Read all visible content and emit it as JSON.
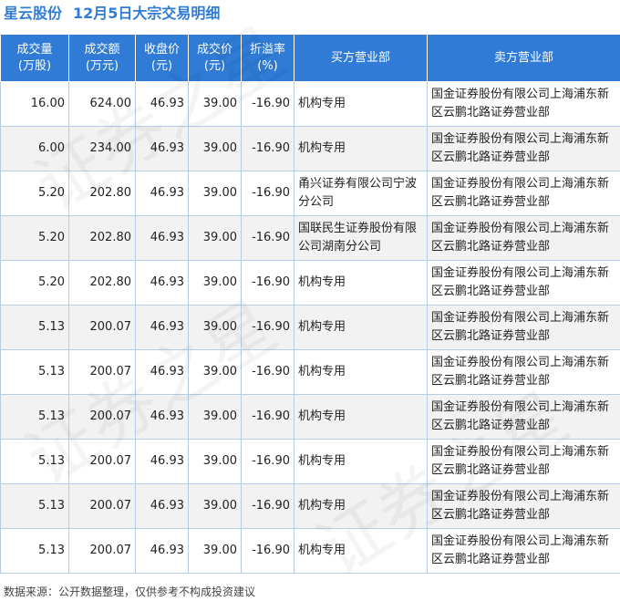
{
  "title": {
    "stock_name": "星云股份",
    "subtitle": "12月5日大宗交易明细"
  },
  "columns": [
    {
      "line1": "成交量",
      "line2": "(万股)"
    },
    {
      "line1": "成交额",
      "line2": "(万元)"
    },
    {
      "line1": "收盘价",
      "line2": "(元)"
    },
    {
      "line1": "成交价",
      "line2": "(元)"
    },
    {
      "line1": "折溢率",
      "line2": "(%)"
    },
    {
      "line1": "买方营业部",
      "line2": ""
    },
    {
      "line1": "卖方营业部",
      "line2": ""
    }
  ],
  "rows": [
    {
      "volume": "16.00",
      "amount": "624.00",
      "close": "46.93",
      "price": "39.00",
      "premium": "-16.90",
      "buyer": "机构专用",
      "seller": "国金证券股份有限公司上海浦东新区云鹏北路证券营业部"
    },
    {
      "volume": "6.00",
      "amount": "234.00",
      "close": "46.93",
      "price": "39.00",
      "premium": "-16.90",
      "buyer": "机构专用",
      "seller": "国金证券股份有限公司上海浦东新区云鹏北路证券营业部"
    },
    {
      "volume": "5.20",
      "amount": "202.80",
      "close": "46.93",
      "price": "39.00",
      "premium": "-16.90",
      "buyer": "甬兴证券有限公司宁波分公司",
      "seller": "国金证券股份有限公司上海浦东新区云鹏北路证券营业部"
    },
    {
      "volume": "5.20",
      "amount": "202.80",
      "close": "46.93",
      "price": "39.00",
      "premium": "-16.90",
      "buyer": "国联民生证券股份有限公司湖南分公司",
      "seller": "国金证券股份有限公司上海浦东新区云鹏北路证券营业部"
    },
    {
      "volume": "5.20",
      "amount": "202.80",
      "close": "46.93",
      "price": "39.00",
      "premium": "-16.90",
      "buyer": "机构专用",
      "seller": "国金证券股份有限公司上海浦东新区云鹏北路证券营业部"
    },
    {
      "volume": "5.13",
      "amount": "200.07",
      "close": "46.93",
      "price": "39.00",
      "premium": "-16.90",
      "buyer": "机构专用",
      "seller": "国金证券股份有限公司上海浦东新区云鹏北路证券营业部"
    },
    {
      "volume": "5.13",
      "amount": "200.07",
      "close": "46.93",
      "price": "39.00",
      "premium": "-16.90",
      "buyer": "机构专用",
      "seller": "国金证券股份有限公司上海浦东新区云鹏北路证券营业部"
    },
    {
      "volume": "5.13",
      "amount": "200.07",
      "close": "46.93",
      "price": "39.00",
      "premium": "-16.90",
      "buyer": "机构专用",
      "seller": "国金证券股份有限公司上海浦东新区云鹏北路证券营业部"
    },
    {
      "volume": "5.13",
      "amount": "200.07",
      "close": "46.93",
      "price": "39.00",
      "premium": "-16.90",
      "buyer": "机构专用",
      "seller": "国金证券股份有限公司上海浦东新区云鹏北路证券营业部"
    },
    {
      "volume": "5.13",
      "amount": "200.07",
      "close": "46.93",
      "price": "39.00",
      "premium": "-16.90",
      "buyer": "机构专用",
      "seller": "国金证券股份有限公司上海浦东新区云鹏北路证券营业部"
    },
    {
      "volume": "5.13",
      "amount": "200.07",
      "close": "46.93",
      "price": "39.00",
      "premium": "-16.90",
      "buyer": "机构专用",
      "seller": "国金证券股份有限公司上海浦东新区云鹏北路证券营业部"
    }
  ],
  "footer": {
    "source": "数据来源：公开数据整理，仅供参考不构成投资建议"
  },
  "watermark": {
    "text": "证券之星"
  },
  "colors": {
    "accent": "#2f7bd6",
    "premium": "#1aa31a",
    "border": "#b7cde6",
    "row_alt": "#f2f2f2"
  }
}
